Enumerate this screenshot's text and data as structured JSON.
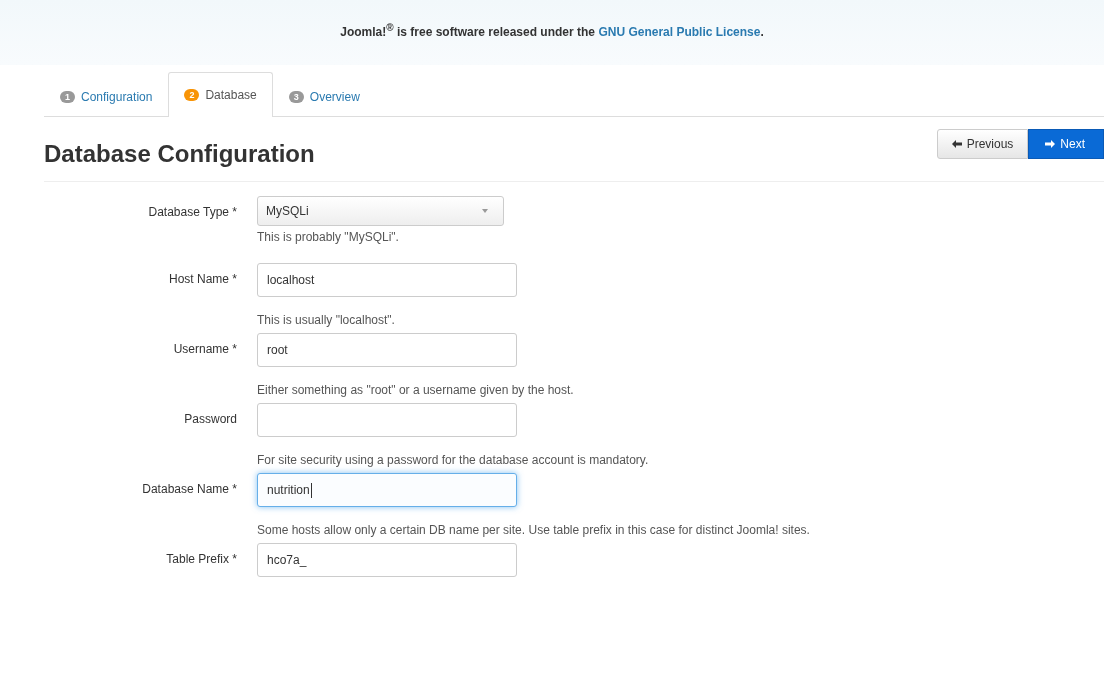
{
  "license_banner": {
    "before": "Joomla!$^{®}$ is free software released under the",
    "link": "GNU General Public License",
    "after": "."
  },
  "tabs": [
    {
      "number": "1",
      "label": "Configuration",
      "selected": false
    },
    {
      "number": "2",
      "label": "Database",
      "selected": true
    },
    {
      "number": "3",
      "label": "Overview",
      "selected": false
    }
  ],
  "heading": "Database Configuration",
  "buttons": [
    {
      "kind": "previous",
      "label": "Previous"
    },
    {
      "kind": "next",
      "label": "Next"
    }
  ],
  "fields": [
    {
      "kind": "select",
      "label": "Database Type *",
      "value": "MySQLi",
      "help": "This is probably \"MySQLi\"."
    },
    {
      "kind": "text",
      "label": "Host Name *",
      "value": "localhost",
      "help": "This is usually \"localhost\".",
      "focused": false
    },
    {
      "kind": "text",
      "label": "Username *",
      "value": "root",
      "help": "Either something as \"root\" or a username given by the host.",
      "focused": false
    },
    {
      "kind": "text",
      "label": "Password",
      "help": "For site security using a password for the database account is mandatory.",
      "focused": false
    },
    {
      "kind": "text",
      "label": "Database Name *",
      "value": "nutrition",
      "help": "Some hosts allow only a certain DB name per site. Use table prefix in this case for distinct Joomla! sites.",
      "focused": true
    },
    {
      "kind": "text",
      "label": "Table Prefix *",
      "value": "hco7a_",
      "focused": false
    }
  ]
}
